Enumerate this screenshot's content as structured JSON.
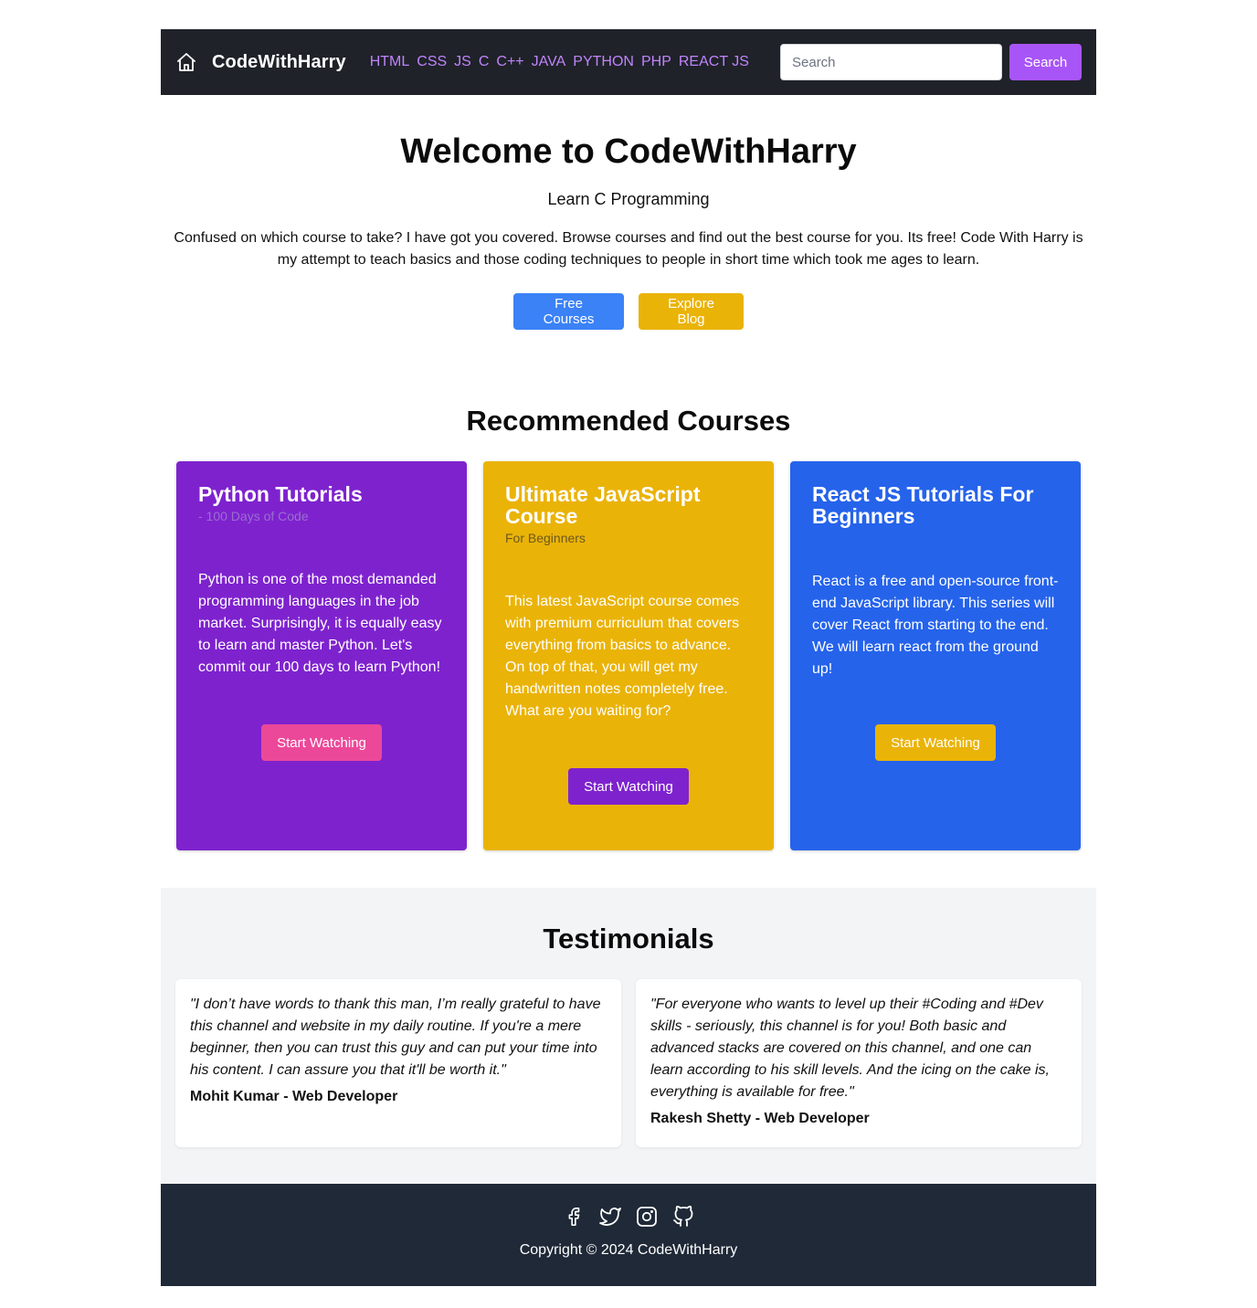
{
  "navbar": {
    "brand": "CodeWithHarry",
    "links": [
      "HTML",
      "CSS",
      "JS",
      "C",
      "C++",
      "JAVA",
      "PYTHON",
      "PHP",
      "REACT JS"
    ],
    "search_placeholder": "Search",
    "search_button": "Search",
    "colors": {
      "background": "#1f2229",
      "link": "#c084fc",
      "search_button": "#a855f7"
    }
  },
  "hero": {
    "title": "Welcome to CodeWithHarry",
    "subtitle": "Learn C Programming",
    "description": "Confused on which course to take? I have got you covered. Browse courses and find out the best course for you. Its free! Code With Harry is my attempt to teach basics and those coding techniques to people in short time which took me ages to learn.",
    "buttons": [
      "Free Courses",
      "Explore Blog"
    ]
  },
  "courses": {
    "heading": "Recommended Courses",
    "items": [
      {
        "title": "Python Tutorials",
        "subtitle": "- 100 Days of Code",
        "text": "Python is one of the most demanded programming languages in the job market. Surprisingly, it is equally easy to learn and master Python. Let's commit our 100 days to learn Python!",
        "button": "Start Watching",
        "bg": "#7e22ce",
        "button_color": "#ec4899"
      },
      {
        "title": "Ultimate JavaScript Course",
        "subtitle": "For Beginners",
        "text": "This latest JavaScript course comes with premium curriculum that covers everything from basics to advance. On top of that, you will get my handwritten notes completely free. What are you waiting for?",
        "button": "Start Watching",
        "bg": "#eab308",
        "button_color": "#7e22ce"
      },
      {
        "title": "React JS Tutorials For Beginners",
        "text": "React is a free and open-source front-end JavaScript library. This series will cover React from starting to the end. We will learn react from the ground up!",
        "button": "Start Watching",
        "bg": "#2563eb",
        "button_color": "#eab308"
      }
    ]
  },
  "testimonials": {
    "heading": "Testimonials",
    "items": [
      {
        "quote": "\"I don’t have words to thank this man, I’m really grateful to have this channel and website in my daily routine. If you're a mere beginner, then you can trust this guy and can put your time into his content. I can assure you that it'll be worth it.\"",
        "author": "Mohit Kumar - Web Developer"
      },
      {
        "quote": "\"For everyone who wants to level up their #Coding and #Dev skills - seriously, this channel is for you! Both basic and advanced stacks are covered on this channel, and one can learn according to his skill levels. And the icing on the cake is, everything is available for free.\"",
        "author": "Rakesh Shetty - Web Developer"
      }
    ]
  },
  "footer": {
    "social_icons": [
      "facebook-icon",
      "twitter-icon",
      "instagram-icon",
      "github-icon"
    ],
    "copyright": "Copyright © 2024 CodeWithHarry"
  }
}
